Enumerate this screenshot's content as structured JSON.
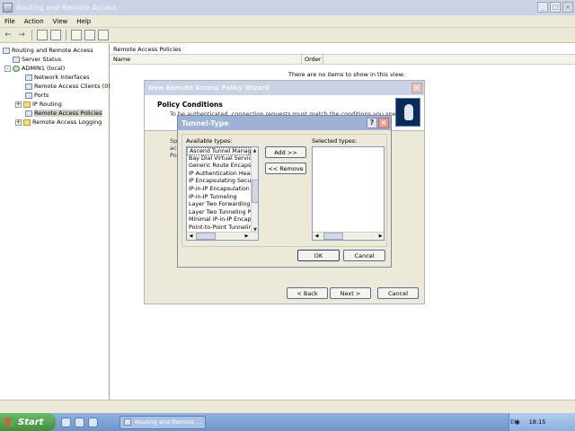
{
  "window": {
    "title": "Routing and Remote Access",
    "min": "_",
    "max": "□",
    "close": "×"
  },
  "menu": [
    "File",
    "Action",
    "View",
    "Help"
  ],
  "toolbar": {
    "back": "←",
    "forward": "→"
  },
  "tree": {
    "items": [
      {
        "label": "Routing and Remote Access",
        "indent": 0,
        "expander": "",
        "icon": "server"
      },
      {
        "label": "Server Status",
        "indent": 1,
        "expander": "",
        "icon": "server"
      },
      {
        "label": "ADMIN1 (local)",
        "indent": 0,
        "expander": "-",
        "icon": "green"
      },
      {
        "label": "Network Interfaces",
        "indent": 2,
        "expander": "",
        "icon": "server"
      },
      {
        "label": "Remote Access Clients (0)",
        "indent": 2,
        "expander": "",
        "icon": "server"
      },
      {
        "label": "Ports",
        "indent": 2,
        "expander": "",
        "icon": "server"
      },
      {
        "label": "IP Routing",
        "indent": 1,
        "expander": "+",
        "icon": "folder"
      },
      {
        "label": "Remote Access Policies",
        "indent": 2,
        "expander": "",
        "icon": "server",
        "selected": true
      },
      {
        "label": "Remote Access Logging",
        "indent": 1,
        "expander": "+",
        "icon": "folder"
      }
    ]
  },
  "right": {
    "caption": "Remote Access Policies",
    "columns": [
      "Name",
      "Order"
    ],
    "empty_message": "There are no items to show in this view."
  },
  "wizard": {
    "title": "New Remote Access Policy Wizard",
    "heading": "Policy Conditions",
    "subheading": "To be authenticated, connection requests must match the conditions you specify.",
    "ghost_left": "Sp",
    "ghost_left2": "ac",
    "ghost_left3": "Po",
    "back": "< Back",
    "next": "Next >",
    "cancel": "Cancel",
    "close": "×"
  },
  "dialog": {
    "title": "Tunnel-Type",
    "help": "?",
    "close": "×",
    "available_label": "Available types:",
    "selected_label": "Selected types:",
    "available_types": [
      "Ascend Tunnel Manag",
      "Bay Dial Virtual Servic",
      "Generic Route Encaps",
      "IP Authentication Head",
      "IP Encapsulating Secu",
      "IP-in-IP Encapsulation",
      "IP-in-IP Tunneling",
      "Layer Two Forwarding",
      "Layer Two Tunneling P",
      "Minimal IP-in-IP Encap",
      "Point-to-Point Tunnelin"
    ],
    "selected_types": [],
    "add": "Add >>",
    "remove": "<< Remove",
    "ok": "OK",
    "cancel": "Cancel"
  },
  "taskbar": {
    "start": "Start",
    "task": "Routing and Remote ...",
    "lang": "EN",
    "clock": "18:15"
  }
}
